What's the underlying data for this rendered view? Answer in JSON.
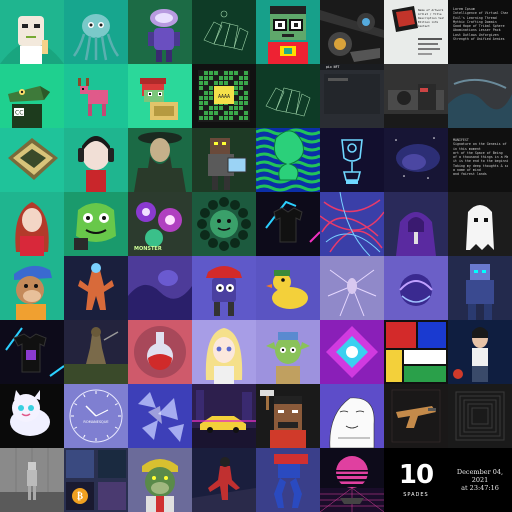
{
  "gallery": {
    "columns": 8,
    "rows": 8,
    "tiles": [
      {
        "name": "avatar-portrait-teal",
        "bg": "#1fb58f"
      },
      {
        "name": "squid-creature",
        "bg": "#17a68e"
      },
      {
        "name": "purple-robot",
        "bg": "#1c6b45"
      },
      {
        "name": "card-hand-green",
        "bg": "#0e3b26"
      },
      {
        "name": "robot-nerd",
        "bg": "#17a08a"
      },
      {
        "name": "mech-machine-dark",
        "bg": "#1a1a1a"
      },
      {
        "name": "card-with-text",
        "bg": "#e9ecea"
      },
      {
        "name": "text-list-dark",
        "bg": "#0d0d0d"
      },
      {
        "name": "crocodile-character",
        "bg": "#1fd08f"
      },
      {
        "name": "pink-pixel-deer",
        "bg": "#1cc496"
      },
      {
        "name": "pixel-turtle",
        "bg": "#2bd89a"
      },
      {
        "name": "qr-pixel-board",
        "bg": "#111"
      },
      {
        "name": "card-hand-green-2",
        "bg": "#0e3b26"
      },
      {
        "name": "dark-screenshot",
        "bg": "#2a2d33"
      },
      {
        "name": "dark-lab-scene",
        "bg": "#333"
      },
      {
        "name": "dark-abstract",
        "bg": "#36393d"
      },
      {
        "name": "rug-carpet",
        "bg": "#1fc39a"
      },
      {
        "name": "headphone-girl",
        "bg": "#1fb58f"
      },
      {
        "name": "cloaked-warrior",
        "bg": "#1b6a45"
      },
      {
        "name": "robot-gamer",
        "bg": "#1e3a25"
      },
      {
        "name": "green-swirl-pattern",
        "bg": "#0b2fa8"
      },
      {
        "name": "neon-cup-trophy",
        "bg": "#120f2e"
      },
      {
        "name": "nebula-space",
        "bg": "#171535"
      },
      {
        "name": "manifest-text",
        "bg": "#101010"
      },
      {
        "name": "red-haired-woman",
        "bg": "#1fb58f"
      },
      {
        "name": "green-monster",
        "bg": "#1a9a6c"
      },
      {
        "name": "psychedelic-flowers",
        "bg": "#2c3b2e"
      },
      {
        "name": "sun-smiley",
        "bg": "#1c5a3e"
      },
      {
        "name": "black-tshirt-neon",
        "bg": "#0d0b1a"
      },
      {
        "name": "tangled-wires",
        "bg": "#3a3fa8"
      },
      {
        "name": "purple-hoodie",
        "bg": "#2a2a5a"
      },
      {
        "name": "hooded-ghost",
        "bg": "#1c1c1c"
      },
      {
        "name": "ape-cap",
        "bg": "#1fb58f"
      },
      {
        "name": "robot-fighter",
        "bg": "#1a1f3d"
      },
      {
        "name": "purple-cave",
        "bg": "#4d3b99"
      },
      {
        "name": "red-cap-cube",
        "bg": "#5f59c9"
      },
      {
        "name": "rubber-duck",
        "bg": "#5a54c2"
      },
      {
        "name": "lavender-spider",
        "bg": "#9089c9"
      },
      {
        "name": "purple-orb",
        "bg": "#6b5fc7"
      },
      {
        "name": "cyber-robot-blue",
        "bg": "#232a4d"
      },
      {
        "name": "neon-tshirt",
        "bg": "#0d0b1a"
      },
      {
        "name": "knight-field",
        "bg": "#23233d"
      },
      {
        "name": "potion-flask",
        "bg": "#cf5a6b"
      },
      {
        "name": "blonde-anime",
        "bg": "#a79de6"
      },
      {
        "name": "goblin-character",
        "bg": "#9d92de"
      },
      {
        "name": "neon-diamond",
        "bg": "#8a1fb8"
      },
      {
        "name": "bauhaus-blocks",
        "bg": "#fff"
      },
      {
        "name": "warrior-woman",
        "bg": "#0f1e40"
      },
      {
        "name": "white-cat-sticker",
        "bg": "#0a0a0a"
      },
      {
        "name": "analog-clock",
        "bg": "#7f7fd1"
      },
      {
        "name": "crystal-shards",
        "bg": "#3d3fb8"
      },
      {
        "name": "yellow-car-city",
        "bg": "#2d1f4d"
      },
      {
        "name": "pixel-man-hammer",
        "bg": "#1a1a1a"
      },
      {
        "name": "sketch-face",
        "bg": "#5d4dc9"
      },
      {
        "name": "pistol-gun",
        "bg": "#1a1818"
      },
      {
        "name": "black-box-pattern",
        "bg": "#1a1a1a"
      },
      {
        "name": "robot-gallery-room",
        "bg": "#7a7a7a"
      },
      {
        "name": "bitcoin-collage",
        "bg": "#2a3050"
      },
      {
        "name": "green-ape-bandana",
        "bg": "#6b6b9a"
      },
      {
        "name": "red-hero-dark",
        "bg": "#1a1e3d"
      },
      {
        "name": "blue-mech-legs",
        "bg": "#3a3f8a"
      },
      {
        "name": "synthwave-sunset",
        "bg": "#0d0b1a"
      },
      {
        "name": "ten-spades-card",
        "bg": "#000"
      },
      {
        "name": "date-card",
        "bg": "#000"
      }
    ]
  },
  "texts": {
    "card_with_text": [
      "Artist / Title",
      "Description text",
      "Edition info",
      "Contact"
    ],
    "text_list_dark": [
      "Lorem Ipsum",
      "Intelligence of Virtual Characters",
      "Evil's Learning Thread",
      "Mythic Crafting Domain",
      "Good Hope of Tribal Sphere",
      "Abominations Lesser Pack",
      "Lost Outlaws Unforgiven",
      "Strength of Unified Armies"
    ],
    "manifest_text": [
      "MANIFEST",
      "Signature on the Genesis of digital",
      "in this moment",
      "art of the Space of Being",
      "of a thousand things in a Metaverse",
      "it is the end to the beginning",
      "Taking my deep thoughts & soul",
      "a name of mind",
      "and fairest lands"
    ],
    "screenshot_label": "pix NFT",
    "pixel_label": "AAAA",
    "monster_label": "MONSTER",
    "ten_spades": {
      "number": "10",
      "suit": "SPADES"
    },
    "date_card": {
      "line1": "December 04, 2021",
      "line2": "at 23:47:16"
    },
    "clock_label": "ROMANESQUE",
    "card_with_text_title": "Name of Artwork"
  }
}
